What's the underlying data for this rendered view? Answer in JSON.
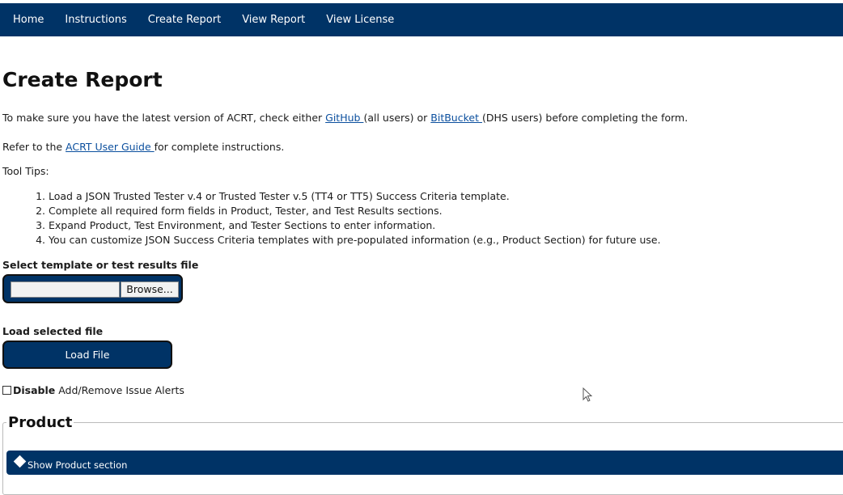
{
  "nav": {
    "items": [
      "Home",
      "Instructions",
      "Create Report",
      "View Report",
      "View License"
    ]
  },
  "page_title": "Create Report",
  "intro": {
    "prefix": "To make sure you have the latest version of ACRT, check either ",
    "link1": "GitHub ",
    "middle": " (all users) or ",
    "link2": "BitBucket ",
    "suffix": " (DHS users) before completing the form."
  },
  "guide": {
    "prefix": "Refer to the ",
    "link": "ACRT User Guide ",
    "suffix": " for complete instructions."
  },
  "tooltips_label": "Tool Tips:",
  "tips": [
    "Load a JSON Trusted Tester v.4 or Trusted Tester v.5 (TT4 or TT5) Success Criteria template.",
    "Complete all required form fields in Product, Tester, and Test Results sections.",
    "Expand Product, Test Environment, and Tester Sections to enter information.",
    "You can customize JSON Success Criteria templates with pre-populated information (e.g., Product Section) for future use."
  ],
  "file_select": {
    "label": "Select template or test results file",
    "value": "",
    "browse_label": "Browse..."
  },
  "load": {
    "label": "Load selected file",
    "button_label": "Load File"
  },
  "alerts_checkbox": {
    "checked": false,
    "bold_label": "Disable",
    "label": " Add/Remove Issue Alerts"
  },
  "product": {
    "legend": "Product",
    "toggle_label": "Show Product section",
    "toggle_icon": "diamond-icon"
  },
  "colors": {
    "navy": "#003366",
    "link": "#0b4f9e"
  }
}
